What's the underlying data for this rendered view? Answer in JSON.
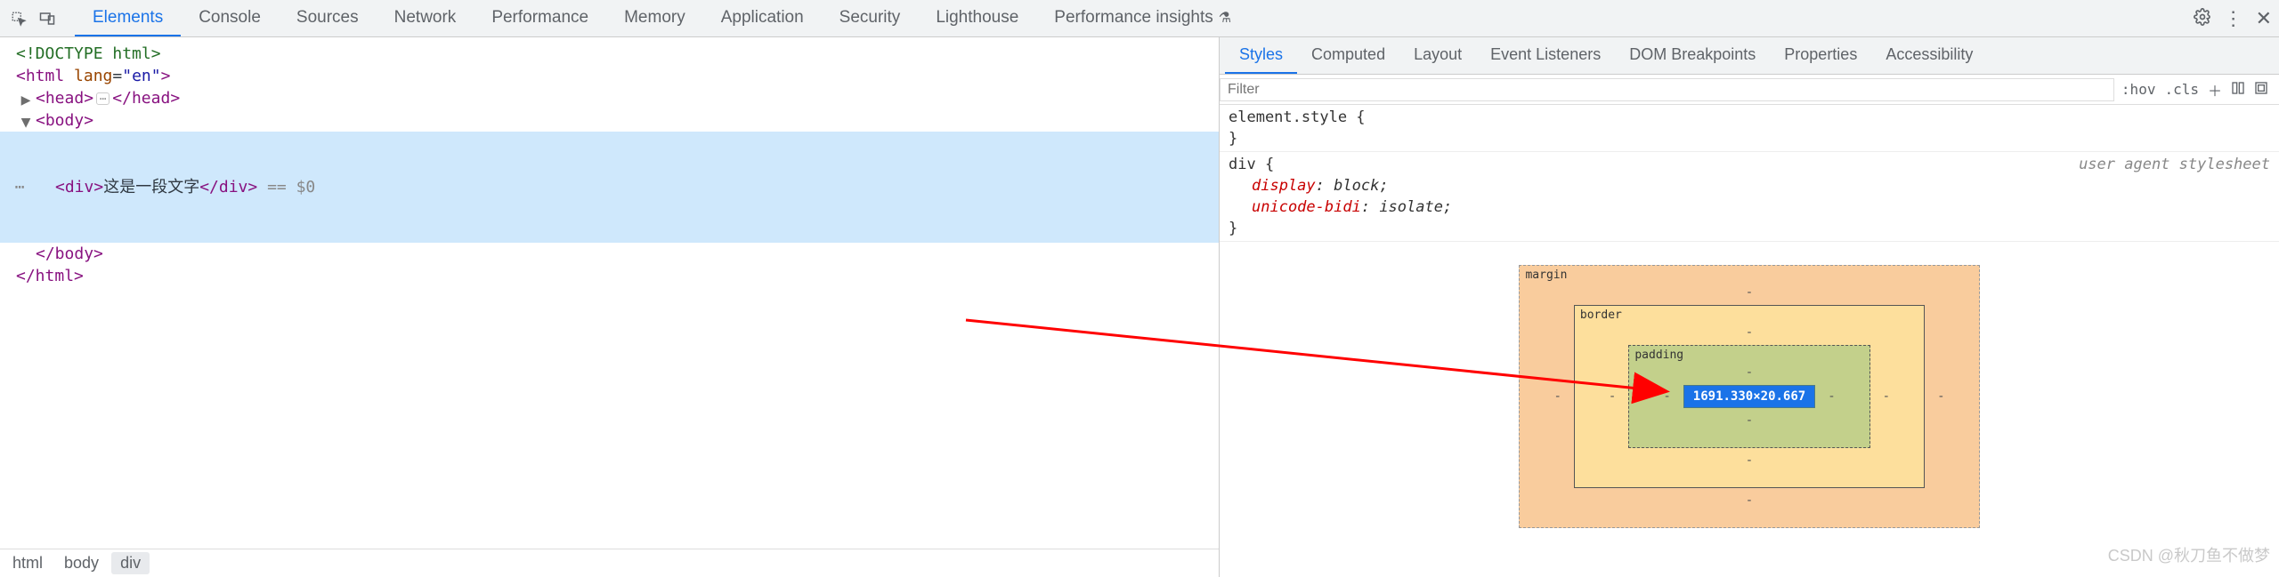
{
  "topTabs": {
    "elements": "Elements",
    "console": "Console",
    "sources": "Sources",
    "network": "Network",
    "performance": "Performance",
    "memory": "Memory",
    "application": "Application",
    "security": "Security",
    "lighthouse": "Lighthouse",
    "perfInsights": "Performance insights"
  },
  "dom": {
    "doctype": "<!DOCTYPE html>",
    "htmlOpen": "html",
    "langAttr": "lang",
    "langVal": "\"en\"",
    "headOpen": "head",
    "headClose": "/head",
    "bodyOpen": "body",
    "divOpen": "div",
    "divText": "这是一段文字",
    "divClose": "/div",
    "selRef": " == $0",
    "bodyClose": "/body",
    "htmlClose": "/html",
    "ellipsis": "⋯"
  },
  "breadcrumbs": {
    "b0": "html",
    "b1": "body",
    "b2": "div"
  },
  "stylesTabs": {
    "styles": "Styles",
    "computed": "Computed",
    "layout": "Layout",
    "eventListeners": "Event Listeners",
    "domBreakpoints": "DOM Breakpoints",
    "properties": "Properties",
    "accessibility": "Accessibility"
  },
  "filter": {
    "placeholder": "Filter",
    "hov": ":hov",
    "cls": ".cls",
    "plus": "＋"
  },
  "rules": {
    "elStyle": "element.style {",
    "close": "}",
    "divSel": "div {",
    "uaLabel": "user agent stylesheet",
    "displayProp": "display",
    "displayVal": "block",
    "bidiProp": "unicode-bidi",
    "bidiVal": "isolate",
    "colon": ": ",
    "semi": ";"
  },
  "boxModel": {
    "margin": "margin",
    "border": "border",
    "padding": "padding",
    "dash": "-",
    "content": "1691.330×20.667"
  },
  "watermark": "CSDN @秋刀鱼不做梦"
}
